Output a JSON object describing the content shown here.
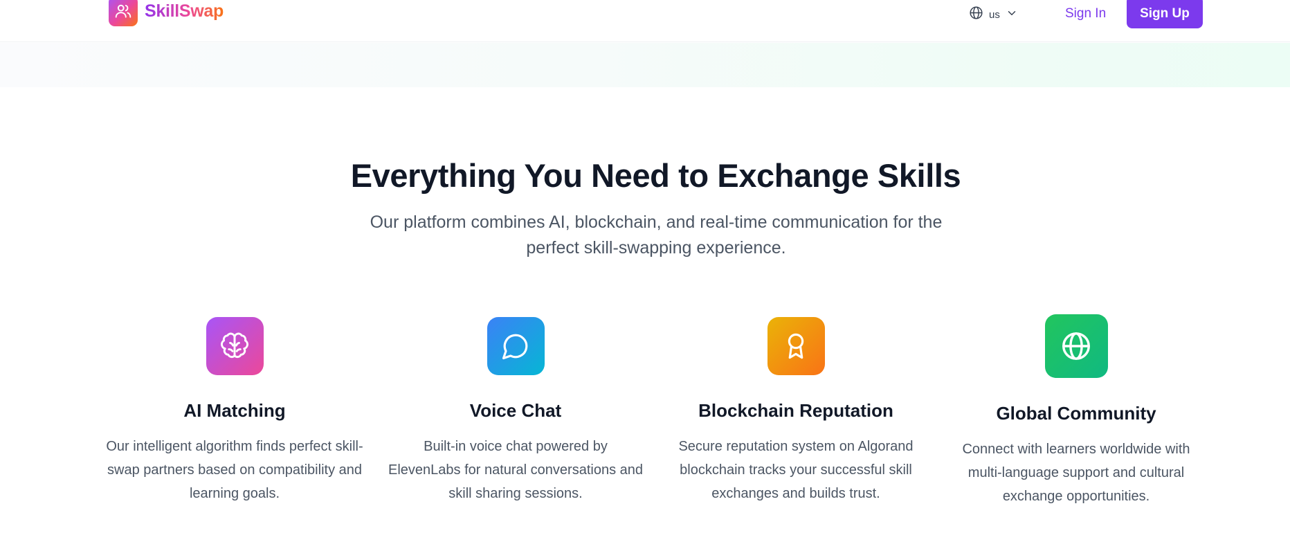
{
  "header": {
    "brand": "SkillSwap",
    "language_code": "us",
    "signin_label": "Sign In",
    "signup_label": "Sign Up"
  },
  "features_section": {
    "title": "Everything You Need to Exchange Skills",
    "subtitle": "Our platform combines AI, blockchain, and real-time communication for the perfect skill-swapping experience."
  },
  "features": [
    {
      "icon": "brain-icon",
      "color_from": "#a855f7",
      "color_to": "#ec4899",
      "title": "AI Matching",
      "description": "Our intelligent algorithm finds perfect skill-swap partners based on compatibility and learning goals."
    },
    {
      "icon": "chat-bubble-icon",
      "color_from": "#3b82f6",
      "color_to": "#06b6d4",
      "title": "Voice Chat",
      "description": "Built-in voice chat powered by ElevenLabs for natural conversations and skill sharing sessions."
    },
    {
      "icon": "award-icon",
      "color_from": "#eab308",
      "color_to": "#f97316",
      "title": "Blockchain Reputation",
      "description": "Secure reputation system on Algorand blockchain tracks your successful skill exchanges and builds trust."
    },
    {
      "icon": "globe-icon",
      "color_from": "#22c55e",
      "color_to": "#10b981",
      "title": "Global Community",
      "description": "Connect with learners worldwide with multi-language support and cultural exchange opportunities."
    }
  ],
  "colors": {
    "accent": "#7c3aed",
    "heading": "#111827",
    "body_text": "#4b5563"
  }
}
